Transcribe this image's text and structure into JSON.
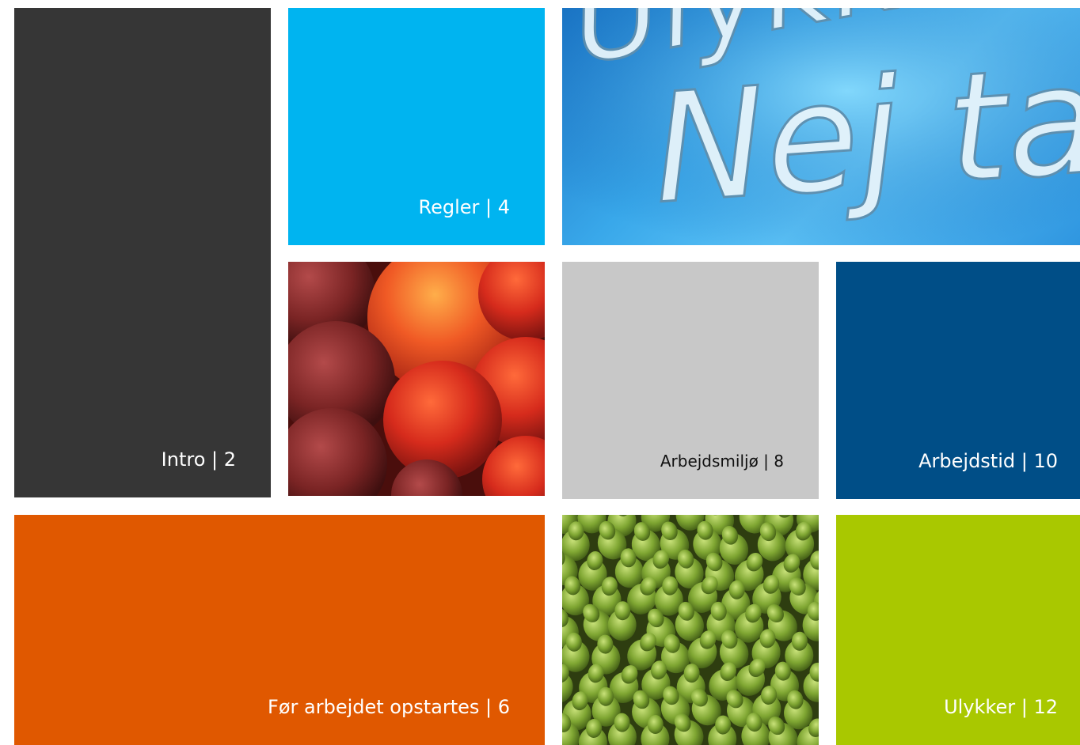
{
  "tiles": {
    "intro": {
      "label": "Intro | 2"
    },
    "regler": {
      "label": "Regler | 4"
    },
    "hero": {
      "line1": "Ulykker",
      "line2": "Nej tak"
    },
    "miljo": {
      "label": "Arbejdsmiljø | 8"
    },
    "tid": {
      "label": "Arbejdstid | 10"
    },
    "for": {
      "label": "Før arbejdet opstartes | 6"
    },
    "ulykker": {
      "label": "Ulykker | 12"
    }
  },
  "images": {
    "apples": "apples-photo",
    "pears": "pears-photo"
  },
  "colors": {
    "intro": "#363636",
    "regler": "#00b4f0",
    "miljo": "#c8c8c8",
    "tid": "#004e87",
    "for": "#e05800",
    "ulykker": "#a9c800"
  }
}
